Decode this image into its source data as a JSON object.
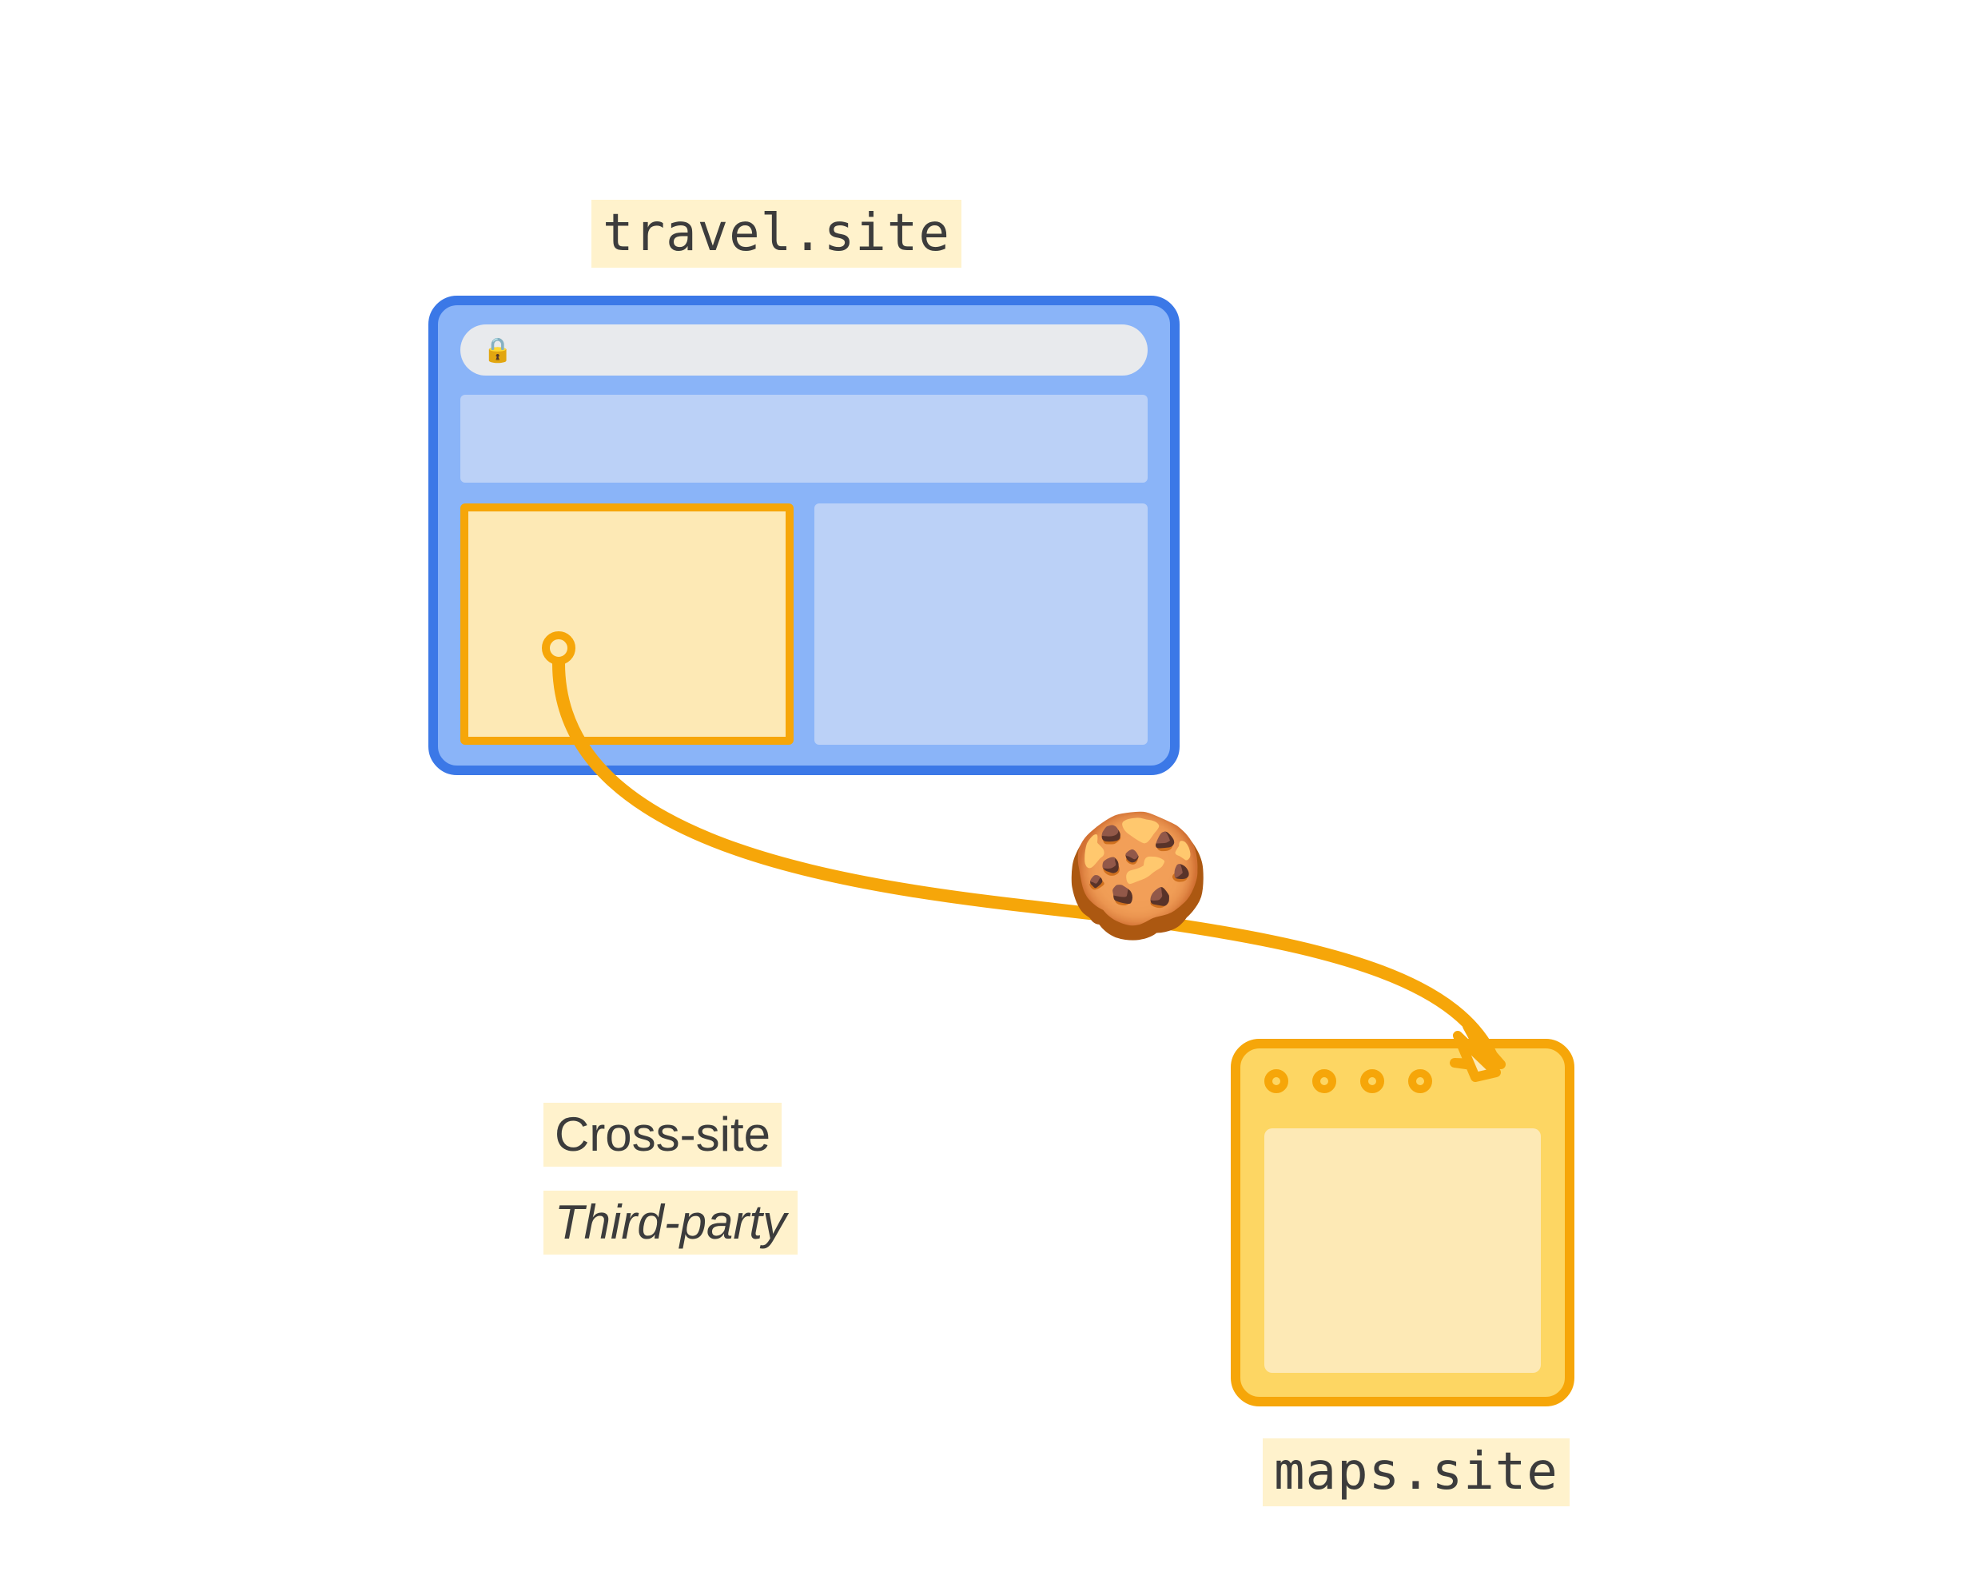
{
  "label_top_domain": "travel.site",
  "label_bottom_domain": "maps.site",
  "label_cross_site": "Cross-site",
  "label_third_party": "Third-party",
  "cookie_emoji": "🍪",
  "lock_glyph": "🔒",
  "colors": {
    "highlight_bg": "#fff2cc",
    "browser_border": "#3b78e7",
    "browser_bg": "#8ab4f8",
    "panel_bg": "#bbd1f7",
    "accent_orange": "#f6a609",
    "accent_orange_light": "#fde9b5",
    "server_bg": "#fdd663"
  }
}
